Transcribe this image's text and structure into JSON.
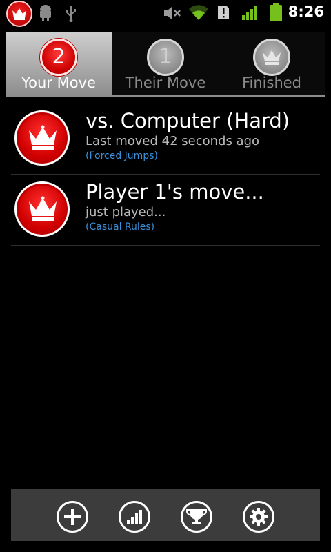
{
  "status_bar": {
    "time": "8:26",
    "icons": [
      "crown-app-icon",
      "android-icon",
      "usb-icon",
      "mute-icon",
      "wifi-icon",
      "alert-icon",
      "signal-icon",
      "battery-icon"
    ]
  },
  "tabs": [
    {
      "label": "Your Move",
      "badge": "2",
      "active": true
    },
    {
      "label": "Their Move",
      "badge": "1",
      "active": false
    },
    {
      "label": "Finished",
      "badge": "",
      "active": false
    }
  ],
  "games": [
    {
      "title": "vs. Computer (Hard)",
      "subtitle": "Last moved 42 seconds ago",
      "rules": "(Forced Jumps)"
    },
    {
      "title": "Player 1's move...",
      "subtitle": "just played...",
      "rules": "(Casual Rules)"
    }
  ],
  "bottom_bar": {
    "buttons": [
      "new-game-icon",
      "stats-icon",
      "trophy-icon",
      "settings-icon"
    ]
  },
  "colors": {
    "accent_red": "#d10000",
    "link_blue": "#3a8fd8",
    "bar_gray": "#3c3c3c"
  }
}
